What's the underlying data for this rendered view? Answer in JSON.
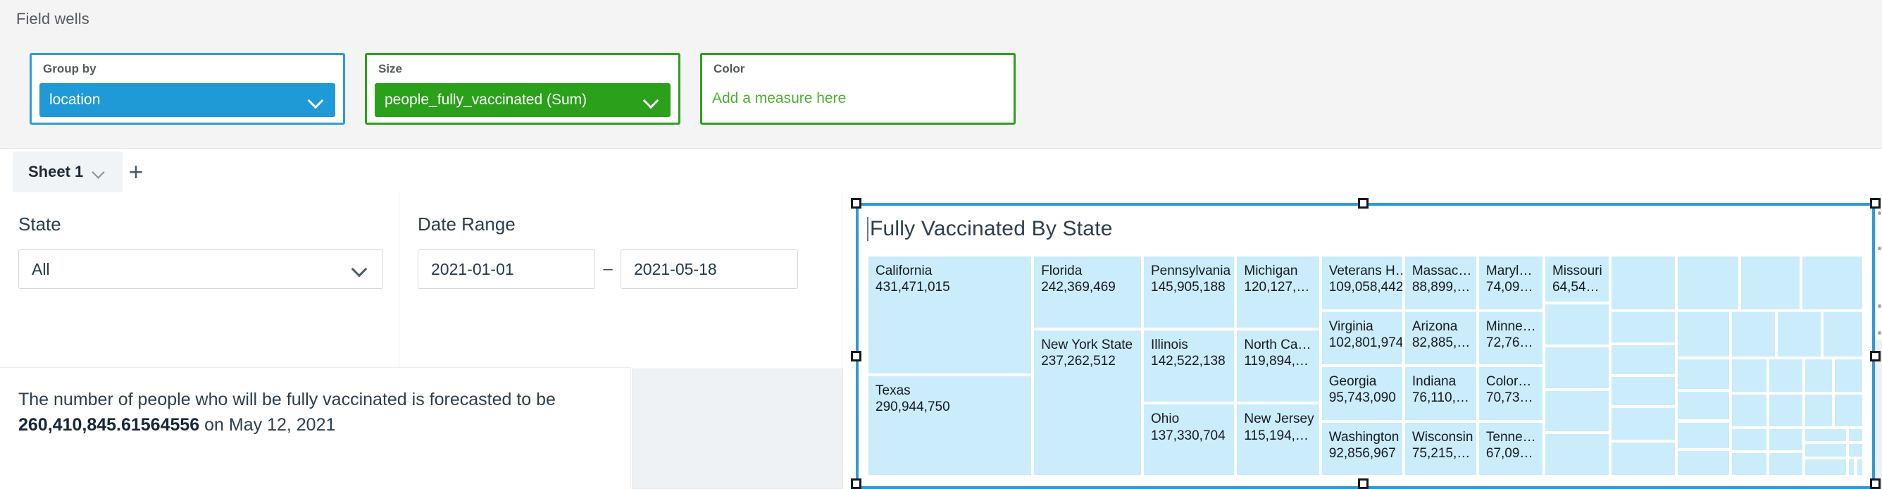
{
  "field_wells": {
    "title": "Field wells",
    "wells": [
      {
        "label": "Group by",
        "value": "location",
        "type": "dimension",
        "color": "#1f9ad6",
        "chevron_icon": "chevron-down-icon"
      },
      {
        "label": "Size",
        "value": "people_fully_vaccinated (Sum)",
        "type": "measure",
        "color": "#2ba01b",
        "chevron_icon": "chevron-down-icon"
      },
      {
        "label": "Color",
        "placeholder": "Add a measure here",
        "type": "empty-measure",
        "color": "#2ba01b"
      }
    ]
  },
  "sheet_bar": {
    "active_tab": "Sheet 1",
    "tab_menu_icon": "chevron-down-icon",
    "add_sheet_icon": "plus-icon",
    "add_sheet_label": "+"
  },
  "controls": {
    "state_filter": {
      "title": "State",
      "selected": "All",
      "chevron_icon": "chevron-down-icon"
    },
    "date_range": {
      "title": "Date Range",
      "start": "2021-01-01",
      "separator": "–",
      "end": "2021-05-18"
    }
  },
  "narrative": {
    "line1": "The number of people who will be fully vaccinated is forecasted to be",
    "value": "260,410,845.61564556",
    "line2_suffix": " on May 12, 2021"
  },
  "visual": {
    "title": "Fully Vaccinated By State",
    "selected": true,
    "selection_color": "#2e9bd6",
    "tile_color": "#cbecfb"
  },
  "chart_data": {
    "type": "treemap",
    "title": "Fully Vaccinated By State",
    "group_by": "location",
    "size_measure": "people_fully_vaccinated (Sum)",
    "color_measure": null,
    "labeled_tiles": [
      {
        "label": "California",
        "value_text": "431,471,015",
        "value": 431471015
      },
      {
        "label": "Texas",
        "value_text": "290,944,750",
        "value": 290944750
      },
      {
        "label": "Florida",
        "value_text": "242,369,469",
        "value": 242369469
      },
      {
        "label": "New York State",
        "value_text": "237,262,512",
        "value": 237262512
      },
      {
        "label": "Pennsylvania",
        "value_text": "145,905,188",
        "value": 145905188
      },
      {
        "label": "Illinois",
        "value_text": "142,522,138",
        "value": 142522138
      },
      {
        "label": "Ohio",
        "value_text": "137,330,704",
        "value": 137330704
      },
      {
        "label": "Michigan",
        "value_text": "120,127,…",
        "value": 120127000
      },
      {
        "label": "North Ca…",
        "value_text": "119,894,…",
        "value": 119894000
      },
      {
        "label": "New Jersey",
        "value_text": "115,194,…",
        "value": 115194000
      },
      {
        "label": "Veterans H…",
        "value_text": "109,058,442",
        "value": 109058442
      },
      {
        "label": "Virginia",
        "value_text": "102,801,974",
        "value": 102801974
      },
      {
        "label": "Georgia",
        "value_text": "95,743,090",
        "value": 95743090
      },
      {
        "label": "Washington",
        "value_text": "92,856,967",
        "value": 92856967
      },
      {
        "label": "Massac…",
        "value_text": "88,899,…",
        "value": 88899000
      },
      {
        "label": "Arizona",
        "value_text": "82,885,…",
        "value": 82885000
      },
      {
        "label": "Indiana",
        "value_text": "76,110,…",
        "value": 76110000
      },
      {
        "label": "Wisconsin",
        "value_text": "75,215,…",
        "value": 75215000
      },
      {
        "label": "Maryl…",
        "value_text": "74,09…",
        "value": 74090000
      },
      {
        "label": "Minne…",
        "value_text": "72,76…",
        "value": 72760000
      },
      {
        "label": "Color…",
        "value_text": "70,73…",
        "value": 70730000
      },
      {
        "label": "Tenne…",
        "value_text": "67,09…",
        "value": 67090000
      },
      {
        "label": "Missouri",
        "value_text": "64,54…",
        "value": 64540000
      }
    ],
    "unlabeled_tile_count": 39,
    "legend": "none",
    "grid": false
  }
}
